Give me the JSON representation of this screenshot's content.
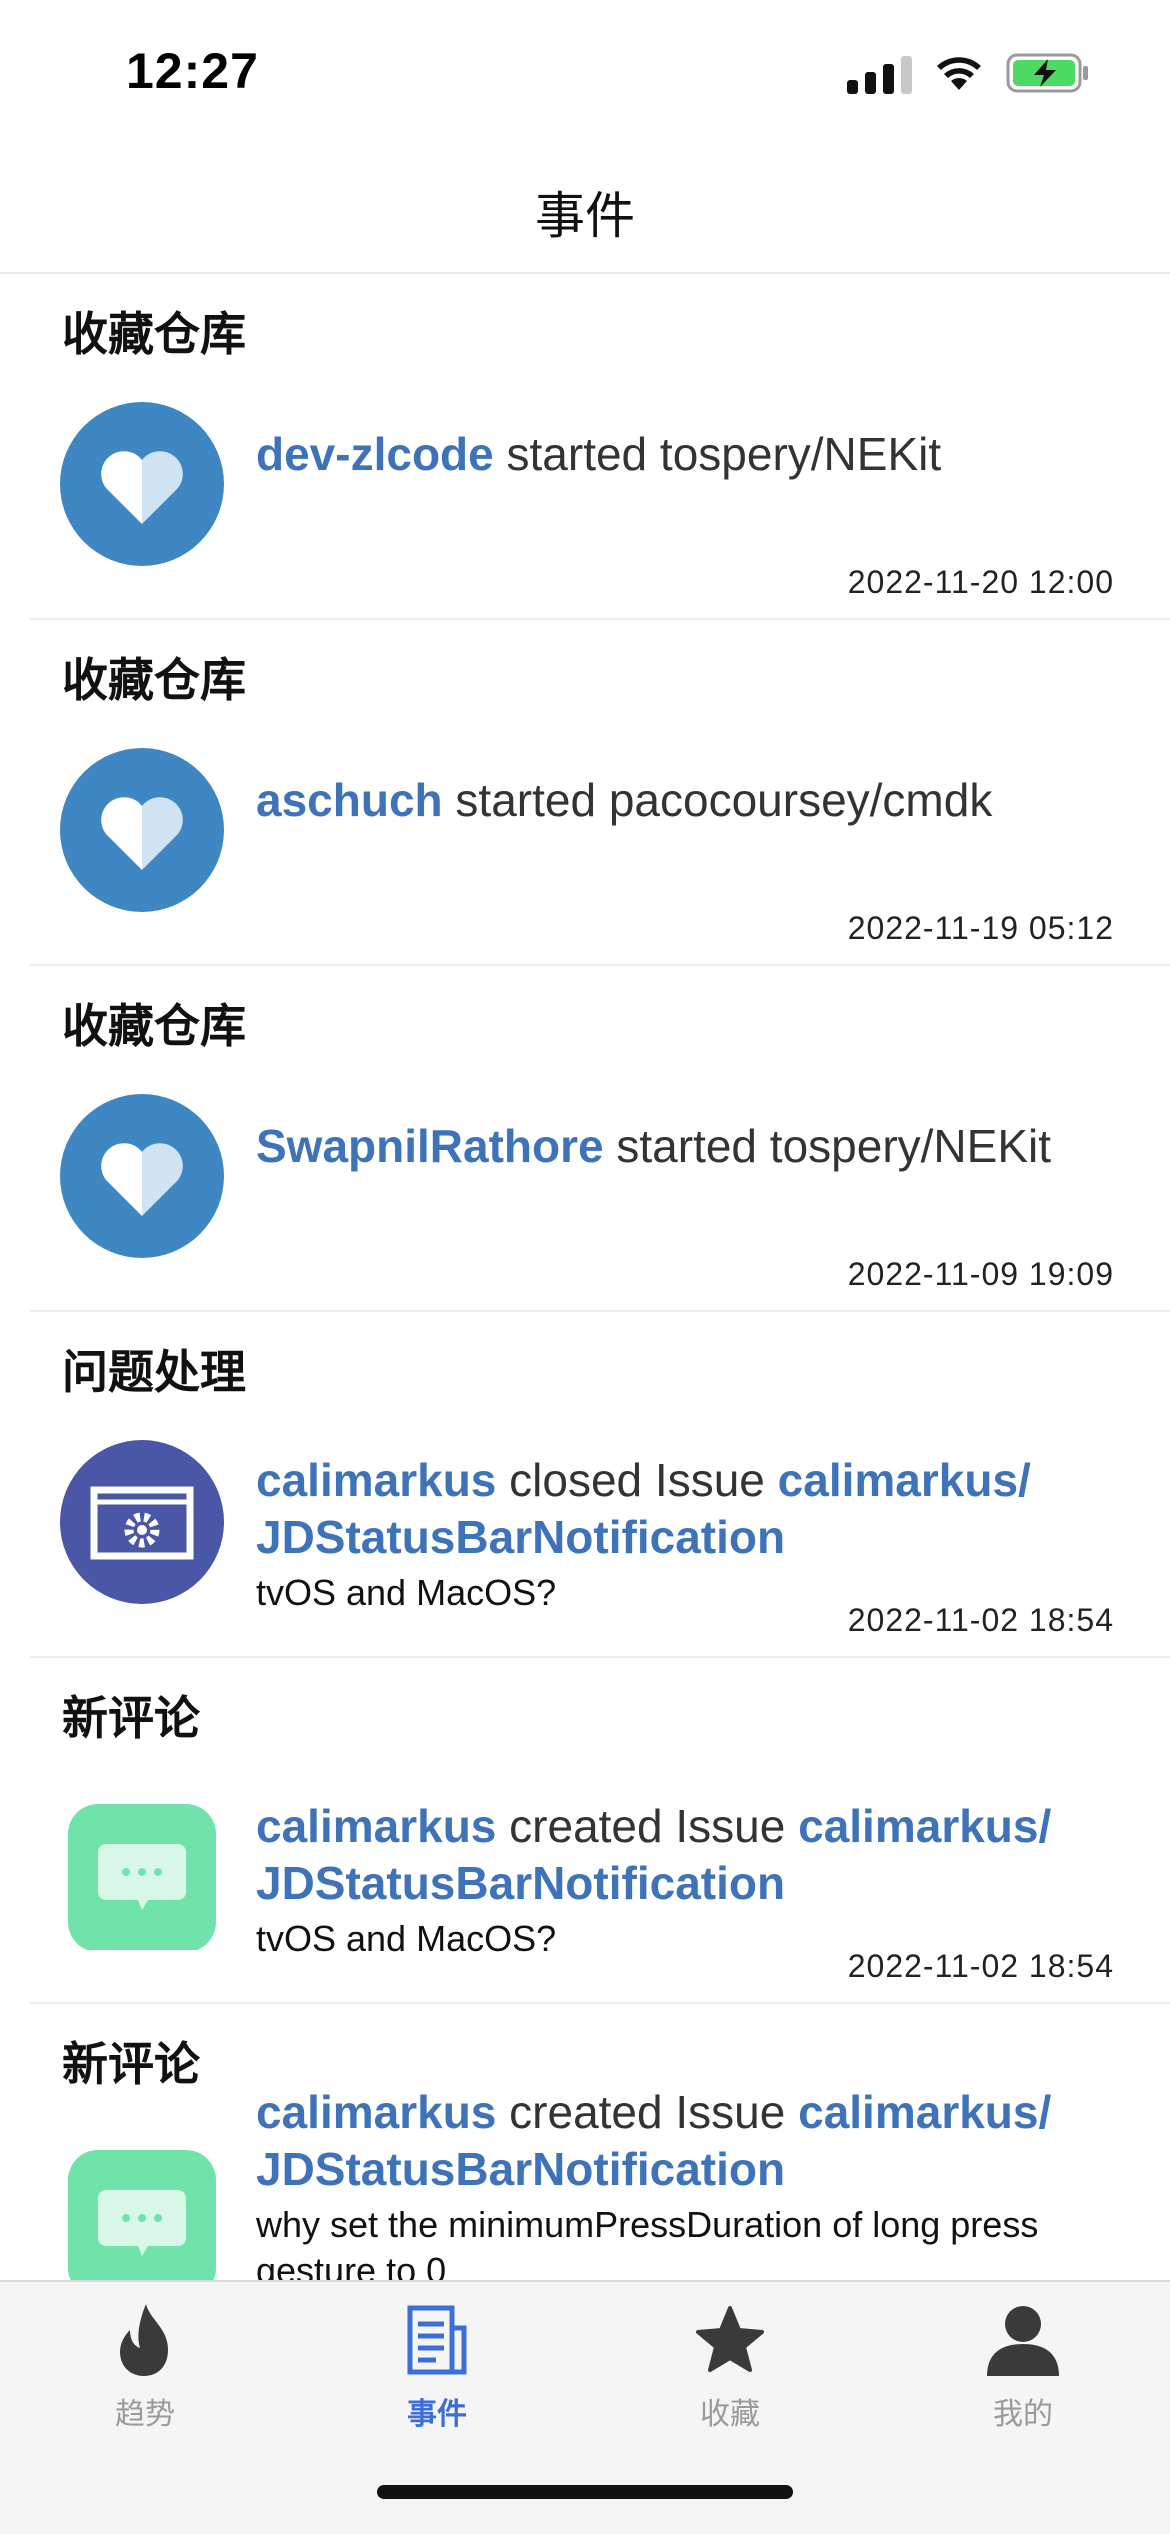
{
  "status": {
    "time": "12:27"
  },
  "nav": {
    "title": "事件"
  },
  "events": [
    {
      "section": "收藏仓库",
      "icon": "heart-icon",
      "user": "dev-zlcode",
      "action": " started tospery/NEKit",
      "date": "2022-11-20 12:00"
    },
    {
      "section": "收藏仓库",
      "icon": "heart-icon",
      "user": "aschuch",
      "action": " started pacocoursey/cmdk",
      "date": "2022-11-19 05:12"
    },
    {
      "section": "收藏仓库",
      "icon": "heart-icon",
      "user": "SwapnilRathore",
      "action": " started tospery/NEKit",
      "date": "2022-11-09 19:09"
    },
    {
      "section": "问题处理",
      "icon": "settings-window-icon",
      "user": "calimarkus",
      "action": " closed Issue ",
      "repo": "calimarkus/ JDStatusBarNotification",
      "body": "tvOS and MacOS?",
      "date": "2022-11-02 18:54"
    },
    {
      "section": "新评论",
      "icon": "comment-icon",
      "user": "calimarkus",
      "action": " created Issue ",
      "repo": "calimarkus/ JDStatusBarNotification",
      "body": "tvOS and MacOS?",
      "date": "2022-11-02 18:54"
    },
    {
      "section": "新评论",
      "icon": "comment-icon",
      "user": "calimarkus",
      "action": " created Issue ",
      "repo": "calimarkus/ JDStatusBarNotification",
      "body": "why set the minimumPressDuration of long press gesture to 0",
      "date": ""
    }
  ],
  "tabs": [
    {
      "label": "趋势",
      "icon": "flame-icon"
    },
    {
      "label": "事件",
      "icon": "document-icon",
      "active": true
    },
    {
      "label": "收藏",
      "icon": "star-icon"
    },
    {
      "label": "我的",
      "icon": "person-icon"
    }
  ],
  "colors": {
    "link": "#3f73b9",
    "heart_bg": "#3e87c3",
    "issue_bg": "#4a56a6",
    "comment_bg": "#6fe3aa",
    "tab_active": "#3b6fd6"
  }
}
